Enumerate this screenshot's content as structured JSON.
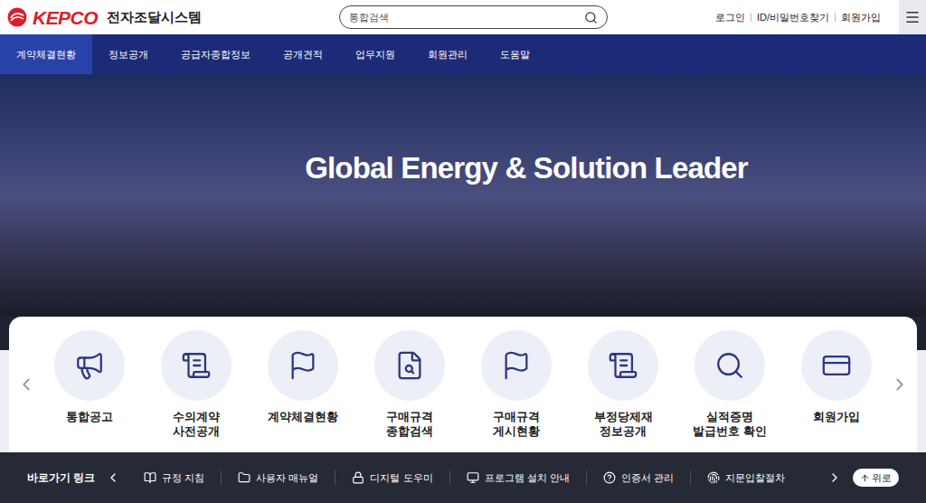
{
  "header": {
    "logo": "KEPCO",
    "title": "전자조달시스템",
    "search": {
      "placeholder": "통합검색"
    },
    "links": [
      "로그인",
      "ID/비밀번호찾기",
      "회원가입"
    ]
  },
  "nav": [
    {
      "label": "계약체결현황",
      "selected": true
    },
    {
      "label": "정보공개",
      "selected": false
    },
    {
      "label": "공급자종합정보",
      "selected": false
    },
    {
      "label": "공개견적",
      "selected": false
    },
    {
      "label": "업무지원",
      "selected": false
    },
    {
      "label": "회원관리",
      "selected": false
    },
    {
      "label": "도움말",
      "selected": false
    }
  ],
  "hero": {
    "headline": "Global Energy & Solution Leader"
  },
  "shortcuts": [
    {
      "lines": [
        "통합공고"
      ]
    },
    {
      "lines": [
        "수의계약",
        "사전공개"
      ]
    },
    {
      "lines": [
        "계약체결현황"
      ]
    },
    {
      "lines": [
        "구매규격",
        "종합검색"
      ]
    },
    {
      "lines": [
        "구매규격",
        "게시현황"
      ]
    },
    {
      "lines": [
        "부정당제재",
        "정보공개"
      ]
    },
    {
      "lines": [
        "실적증명",
        "발급번호 확인"
      ]
    },
    {
      "lines": [
        "회원가입"
      ]
    }
  ],
  "quick_links": {
    "title": "바로가기 링크",
    "items": [
      "규정 지침",
      "사용자 매뉴얼",
      "디지털 도우미",
      "프로그램 설치 안내",
      "인증서 관리",
      "지문입찰절차"
    ],
    "top_button": "위로"
  }
}
